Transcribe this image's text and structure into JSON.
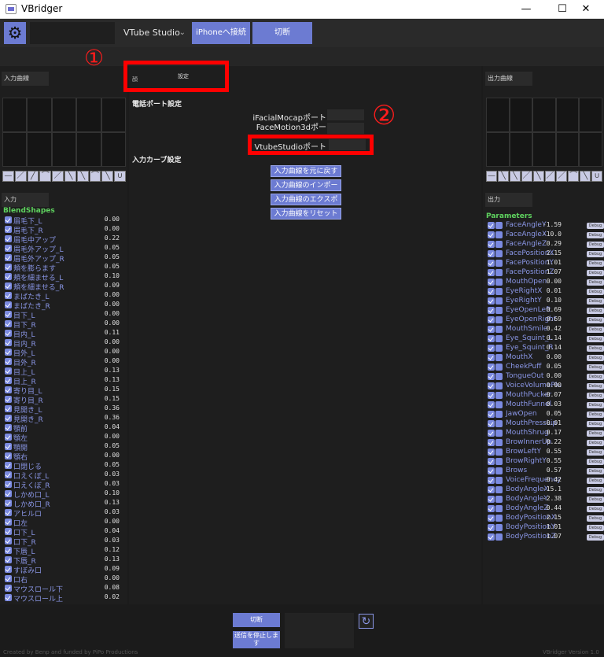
{
  "window": {
    "title": "VBridger",
    "minimize": "—",
    "maximize": "☐",
    "close": "✕"
  },
  "toolbar": {
    "dropdown_value": "VTube Studio",
    "connect_label": "iPhoneへ接続",
    "disconnect_label": "切断"
  },
  "annotations": {
    "one": "①",
    "two": "②"
  },
  "left_panel": {
    "input_curve_header": "入力曲線",
    "input_header": "入力",
    "section": "BlendShapes",
    "items": [
      {
        "name": "眉毛下_L",
        "value": "0.00"
      },
      {
        "name": "眉毛下_R",
        "value": "0.00"
      },
      {
        "name": "眉毛中アップ",
        "value": "0.22"
      },
      {
        "name": "眉毛外アップ_L",
        "value": "0.05"
      },
      {
        "name": "眉毛外アップ_R",
        "value": "0.05"
      },
      {
        "name": "頬を膨らます",
        "value": "0.05"
      },
      {
        "name": "頬を細ませる_L",
        "value": "0.10"
      },
      {
        "name": "頬を細ませる_R",
        "value": "0.09"
      },
      {
        "name": "まばたき_L",
        "value": "0.00"
      },
      {
        "name": "まばたき_R",
        "value": "0.00"
      },
      {
        "name": "目下_L",
        "value": "0.00"
      },
      {
        "name": "目下_R",
        "value": "0.00"
      },
      {
        "name": "目内_L",
        "value": "0.11"
      },
      {
        "name": "目内_R",
        "value": "0.00"
      },
      {
        "name": "目外_L",
        "value": "0.00"
      },
      {
        "name": "目外_R",
        "value": "0.00"
      },
      {
        "name": "目上_L",
        "value": "0.13"
      },
      {
        "name": "目上_R",
        "value": "0.13"
      },
      {
        "name": "寄り目_L",
        "value": "0.15"
      },
      {
        "name": "寄り目_R",
        "value": "0.15"
      },
      {
        "name": "見開き_L",
        "value": "0.36"
      },
      {
        "name": "見開き_R",
        "value": "0.36"
      },
      {
        "name": "顎前",
        "value": "0.04"
      },
      {
        "name": "顎左",
        "value": "0.00"
      },
      {
        "name": "顎開",
        "value": "0.05"
      },
      {
        "name": "顎右",
        "value": "0.00"
      },
      {
        "name": "口閉じる",
        "value": "0.05"
      },
      {
        "name": "口えくぼ_L",
        "value": "0.03"
      },
      {
        "name": "口えくぼ_R",
        "value": "0.03"
      },
      {
        "name": "しかめ口_L",
        "value": "0.10"
      },
      {
        "name": "しかめ口_R",
        "value": "0.13"
      },
      {
        "name": "アヒルロ",
        "value": "0.03"
      },
      {
        "name": "口左",
        "value": "0.00"
      },
      {
        "name": "口下_L",
        "value": "0.04"
      },
      {
        "name": "口下_R",
        "value": "0.03"
      },
      {
        "name": "下唇_L",
        "value": "0.12"
      },
      {
        "name": "下唇_R",
        "value": "0.13"
      },
      {
        "name": "すぼみ口",
        "value": "0.09"
      },
      {
        "name": "口右",
        "value": "0.00"
      },
      {
        "name": "マウスロール下",
        "value": "0.08"
      },
      {
        "name": "マウスロール上",
        "value": "0.02"
      }
    ]
  },
  "center_panel": {
    "tab_left": "顔",
    "tab_right": "設定",
    "phone_port_title": "電話ポート設定",
    "port_labels": [
      "iFacialMocapポート",
      "FaceMotion3dポー",
      "VtubeStudioポート"
    ],
    "curve_title": "入力カーブ設定",
    "buttons": [
      "入力曲線を元に戻す",
      "入力曲線のインポート",
      "入力曲線のエクスポート",
      "入力曲線をリセット"
    ]
  },
  "right_panel": {
    "output_curve_header": "出力曲線",
    "output_header": "出力",
    "section": "Parameters",
    "debug_label": "Debug",
    "items": [
      {
        "name": "FaceAngleY",
        "value": "-1.59"
      },
      {
        "name": "FaceAngleX",
        "value": "-10.0"
      },
      {
        "name": "FaceAngleZ",
        "value": "0.29"
      },
      {
        "name": "FacePositionX",
        "value": "2.15"
      },
      {
        "name": "FacePositionY",
        "value": "1.01"
      },
      {
        "name": "FacePositionZ",
        "value": "1.07"
      },
      {
        "name": "MouthOpen",
        "value": "0.00"
      },
      {
        "name": "EyeRightX",
        "value": "0.01"
      },
      {
        "name": "EyeRightY",
        "value": "0.10"
      },
      {
        "name": "EyeOpenLeft",
        "value": "0.69"
      },
      {
        "name": "EyeOpenRight",
        "value": "0.69"
      },
      {
        "name": "MouthSmile",
        "value": "0.42"
      },
      {
        "name": "Eye_Squint_L",
        "value": "0.14"
      },
      {
        "name": "Eye_Squint_R",
        "value": "0.14"
      },
      {
        "name": "MouthX",
        "value": "0.00"
      },
      {
        "name": "CheekPuff",
        "value": "0.05"
      },
      {
        "name": "TongueOut",
        "value": "0.00"
      },
      {
        "name": "VoiceVolumePlu",
        "value": "0.00"
      },
      {
        "name": "MouthPucker",
        "value": "-0.07"
      },
      {
        "name": "MouthFunnel",
        "value": "0.03"
      },
      {
        "name": "JawOpen",
        "value": "0.05"
      },
      {
        "name": "MouthPressLip",
        "value": "-0.01"
      },
      {
        "name": "MouthShrug",
        "value": "0.17"
      },
      {
        "name": "BrowInnerUp",
        "value": "0.22"
      },
      {
        "name": "BrowLeftY",
        "value": "0.55"
      },
      {
        "name": "BrowRightY",
        "value": "0.55"
      },
      {
        "name": "Brows",
        "value": "0.57"
      },
      {
        "name": "VoiceFrequency",
        "value": "0.42"
      },
      {
        "name": "BodyAngleX",
        "value": "-15.1"
      },
      {
        "name": "BodyAngleY",
        "value": "-2.38"
      },
      {
        "name": "BodyAngleZ",
        "value": "0.44"
      },
      {
        "name": "BodyPositionX",
        "value": "2.15"
      },
      {
        "name": "BodyPositionY",
        "value": "1.01"
      },
      {
        "name": "BodyPositionZ",
        "value": "1.07"
      }
    ]
  },
  "footer": {
    "disconnect_label": "切断",
    "stop_send_label": "送信を停止します",
    "credit": "Created by Benp and funded by PiPo Productions",
    "version": "VBridger Version 1.0"
  }
}
